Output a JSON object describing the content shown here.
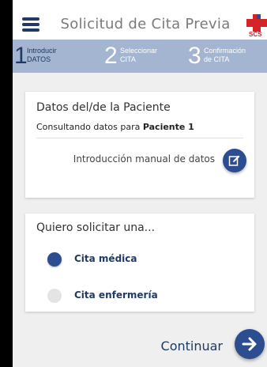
{
  "header": {
    "title": "Solicitud de Cita Previa",
    "logo_text": "SCS",
    "menu_icon": "hamburger-menu-icon"
  },
  "steps": [
    {
      "number": "1",
      "line1": "Introducir",
      "line2": "DATOS",
      "active": true
    },
    {
      "number": "2",
      "line1": "Seleccionar",
      "line2": "CITA",
      "active": false
    },
    {
      "number": "3",
      "line1": "Confirmación",
      "line2": "de CITA",
      "active": false
    }
  ],
  "patient_card": {
    "title": "Datos del/de la Paciente",
    "consulting_prefix": "Consultando datos para",
    "patient_name": "Paciente 1",
    "manual_entry_label": "Introducción manual de datos",
    "manual_entry_icon": "edit-icon"
  },
  "request_card": {
    "title": "Quiero solicitar una...",
    "options": [
      {
        "label": "Cita médica",
        "selected": true
      },
      {
        "label": "Cita enfermería",
        "selected": false
      }
    ]
  },
  "footer": {
    "continue_label": "Continuar",
    "continue_icon": "arrow-right-icon"
  },
  "colors": {
    "primary": "#2c4d8f",
    "navy_text": "#1f3a64",
    "step_bar": "#a3b5d0",
    "logo_red": "#d4242a"
  }
}
